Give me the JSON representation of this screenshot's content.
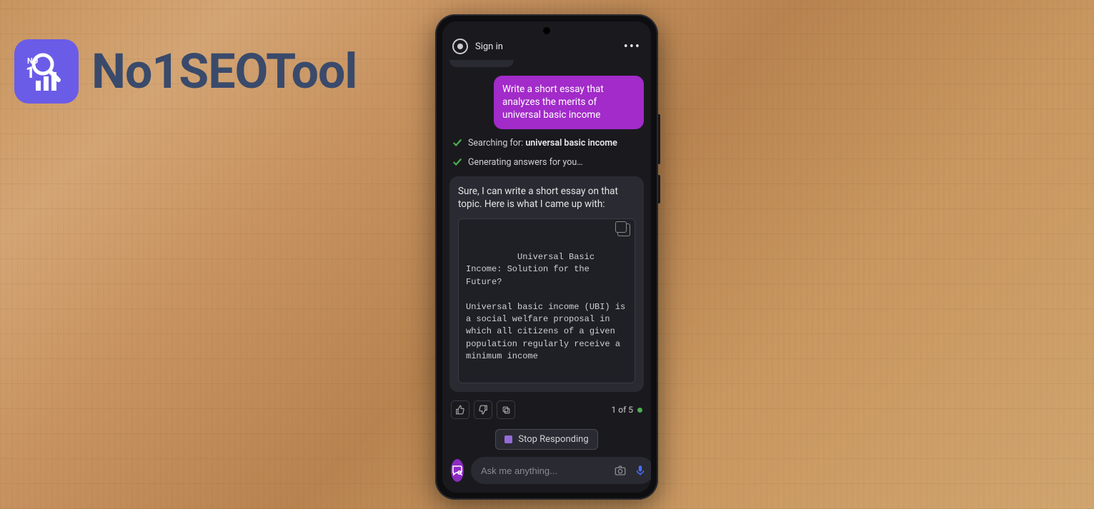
{
  "watermark": {
    "text": "No1SEOTool"
  },
  "header": {
    "signin_label": "Sign in",
    "more_glyph": "•••"
  },
  "chat": {
    "user_message": "Write a short essay that analyzes the merits of universal basic income",
    "status": {
      "searching_prefix": "Searching for: ",
      "searching_query": "universal basic income",
      "generating": "Generating answers for you…"
    },
    "ai_intro": "Sure, I can write a short essay on that topic. Here is what I came up with:",
    "essay": "Universal Basic Income: Solution for the Future?\n\nUniversal basic income (UBI) is a social welfare proposal in which all citizens of a given population regularly receive a minimum income",
    "counter_text": "1 of 5",
    "stop_label": "Stop Responding"
  },
  "input": {
    "placeholder": "Ask me anything..."
  }
}
